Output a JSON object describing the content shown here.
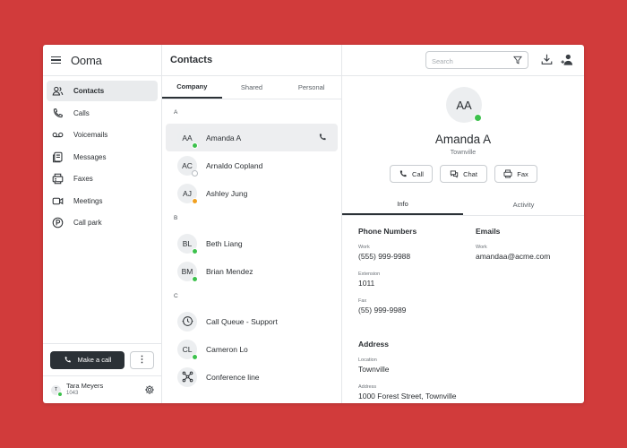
{
  "app": {
    "brand": "Ooma"
  },
  "sidebar": {
    "items": [
      {
        "label": "Contacts",
        "icon": "contacts-icon",
        "active": true
      },
      {
        "label": "Calls",
        "icon": "phone-icon"
      },
      {
        "label": "Voicemails",
        "icon": "voicemail-icon"
      },
      {
        "label": "Messages",
        "icon": "messages-icon"
      },
      {
        "label": "Faxes",
        "icon": "fax-icon"
      },
      {
        "label": "Meetings",
        "icon": "video-icon"
      },
      {
        "label": "Call park",
        "icon": "parking-icon"
      }
    ],
    "make_call_label": "Make a call",
    "more_label": "⋮",
    "user": {
      "initial": "T",
      "name": "Tara Meyers",
      "ext": "1043"
    }
  },
  "header": {
    "title": "Contacts",
    "search_placeholder": "Search"
  },
  "list_tabs": [
    {
      "label": "Company",
      "active": true
    },
    {
      "label": "Shared"
    },
    {
      "label": "Personal"
    }
  ],
  "contacts": {
    "sections": [
      {
        "letter": "A",
        "items": [
          {
            "initials": "AA",
            "name": "Amanda A",
            "status": "online",
            "selected": true
          },
          {
            "initials": "AC",
            "name": "Arnaldo Copland",
            "status": "offline"
          },
          {
            "initials": "AJ",
            "name": "Ashley Jung",
            "status": "away"
          }
        ]
      },
      {
        "letter": "B",
        "items": [
          {
            "initials": "BL",
            "name": "Beth Liang",
            "status": "online"
          },
          {
            "initials": "BM",
            "name": "Brian Mendez",
            "status": "online"
          }
        ]
      },
      {
        "letter": "C",
        "items": [
          {
            "initials": "",
            "name": "Call Queue - Support",
            "icon": "call-queue-icon"
          },
          {
            "initials": "CL",
            "name": "Cameron Lo",
            "status": "online"
          },
          {
            "initials": "",
            "name": "Conference line",
            "icon": "conference-icon"
          }
        ]
      }
    ]
  },
  "detail": {
    "initials": "AA",
    "name": "Amanda A",
    "location": "Townville",
    "actions": {
      "call": "Call",
      "chat": "Chat",
      "fax": "Fax"
    },
    "tabs": {
      "info": "Info",
      "activity": "Activity"
    },
    "phone_numbers": {
      "title": "Phone Numbers",
      "work_label": "Work",
      "work_value": "(555) 999-9988",
      "ext_label": "Extension",
      "ext_value": "1011",
      "fax_label": "Fax",
      "fax_value": "(55) 999-9989"
    },
    "emails": {
      "title": "Emails",
      "work_label": "Work",
      "work_value": "amandaa@acme.com"
    },
    "address": {
      "title": "Address",
      "location_label": "Location",
      "location_value": "Townville",
      "address_label": "Address",
      "address_value": "1000 Forest Street, Townville"
    }
  },
  "colors": {
    "background": "#d13b3b",
    "online": "#3cc14c",
    "away": "#f0a020",
    "offline": "#b9bec3",
    "primary_button": "#2b3136"
  }
}
